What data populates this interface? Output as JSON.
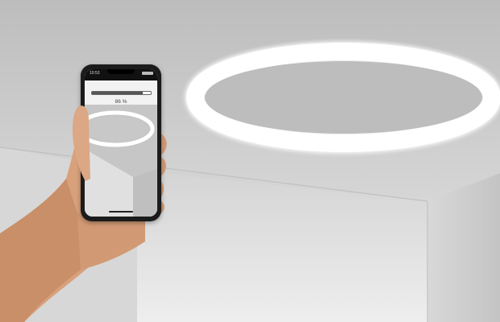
{
  "phone": {
    "status_time": "10:53",
    "progress": {
      "percent": 86,
      "label": "86 %"
    }
  },
  "colors": {
    "ceiling": "#c9c9c9",
    "wall_left": "#d9d9d9",
    "wall_back": "#e2e2e2",
    "wall_right": "#cdcdcd",
    "ring_light": "#ffffff",
    "skin": "#d9a07a",
    "phone_body": "#1b1b1b"
  }
}
